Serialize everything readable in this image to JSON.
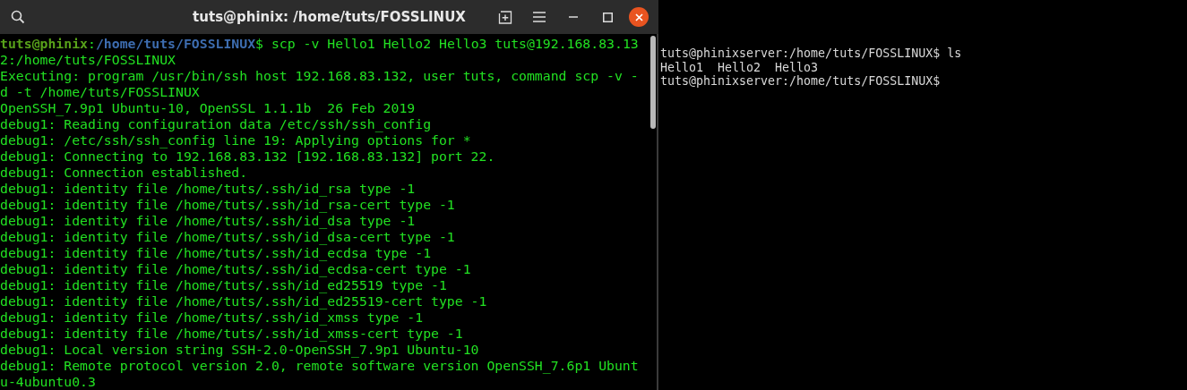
{
  "left_window": {
    "title": "tuts@phinix: /home/tuts/FOSSLINUX",
    "prompt": {
      "user_host": "tuts@phinix",
      "separator": ":",
      "path": "/home/tuts/FOSSLINUX",
      "symbol": "$",
      "command": " scp -v Hello1 Hello2 Hello3 tuts@192.168.83.13"
    },
    "output": [
      "2:/home/tuts/FOSSLINUX",
      "Executing: program /usr/bin/ssh host 192.168.83.132, user tuts, command scp -v -",
      "d -t /home/tuts/FOSSLINUX",
      "OpenSSH_7.9p1 Ubuntu-10, OpenSSL 1.1.1b  26 Feb 2019",
      "debug1: Reading configuration data /etc/ssh/ssh_config",
      "debug1: /etc/ssh/ssh_config line 19: Applying options for *",
      "debug1: Connecting to 192.168.83.132 [192.168.83.132] port 22.",
      "debug1: Connection established.",
      "debug1: identity file /home/tuts/.ssh/id_rsa type -1",
      "debug1: identity file /home/tuts/.ssh/id_rsa-cert type -1",
      "debug1: identity file /home/tuts/.ssh/id_dsa type -1",
      "debug1: identity file /home/tuts/.ssh/id_dsa-cert type -1",
      "debug1: identity file /home/tuts/.ssh/id_ecdsa type -1",
      "debug1: identity file /home/tuts/.ssh/id_ecdsa-cert type -1",
      "debug1: identity file /home/tuts/.ssh/id_ed25519 type -1",
      "debug1: identity file /home/tuts/.ssh/id_ed25519-cert type -1",
      "debug1: identity file /home/tuts/.ssh/id_xmss type -1",
      "debug1: identity file /home/tuts/.ssh/id_xmss-cert type -1",
      "debug1: Local version string SSH-2.0-OpenSSH_7.9p1 Ubuntu-10",
      "debug1: Remote protocol version 2.0, remote software version OpenSSH_7.6p1 Ubunt",
      "u-4ubuntu0.3"
    ]
  },
  "right_console": {
    "lines": [
      "tuts@phinixserver:/home/tuts/FOSSLINUX$ ls",
      "Hello1  Hello2  Hello3",
      "tuts@phinixserver:/home/tuts/FOSSLINUX$"
    ]
  }
}
